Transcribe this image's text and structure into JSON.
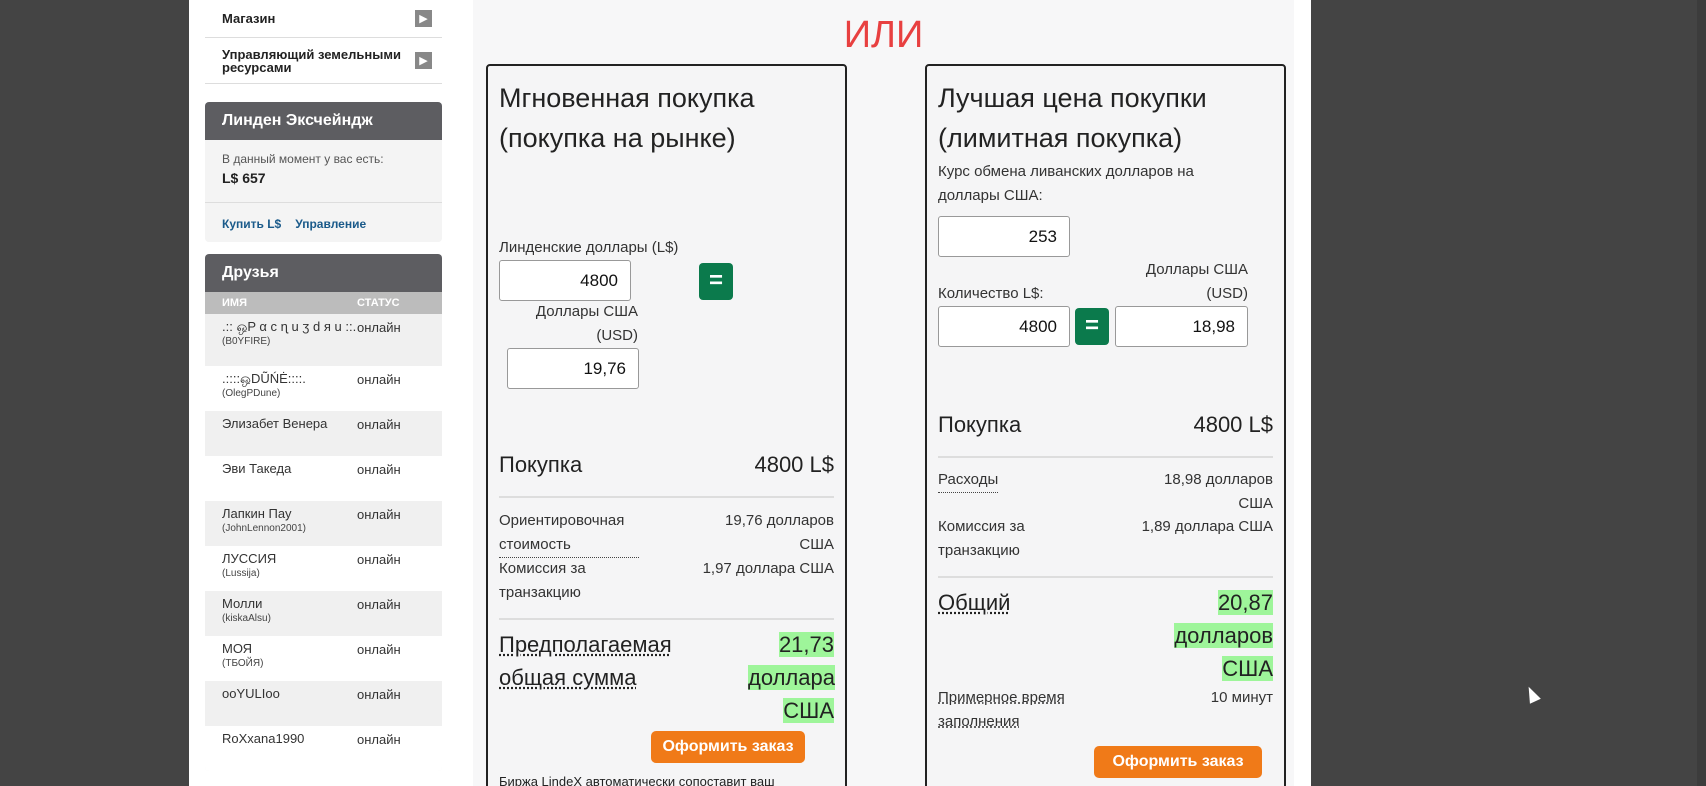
{
  "sidebar": {
    "links": [
      {
        "label": "Магазин"
      },
      {
        "label": "Управляющий земельными ресурсами"
      }
    ],
    "exchange": {
      "title": "Линден Эксчейндж",
      "balance_label": "В данный момент у вас есть:",
      "balance": "L$ 657",
      "buy_link": "Купить L$",
      "manage_link": "Управление"
    },
    "friends": {
      "title": "Друзья",
      "col_name": "ИМЯ",
      "col_status": "СТАТУС",
      "items": [
        {
          "name": ".:: ஒP α ϲ ɳ u ʒ d я u ::.",
          "sub": "(B0YFIRE)",
          "status": "онлайн"
        },
        {
          "name": ".::::ஒDŨŃĖ::::.",
          "sub": "(OlegPDune)",
          "status": "онлайн"
        },
        {
          "name": "Элизабет Венера",
          "sub": "",
          "status": "онлайн"
        },
        {
          "name": "Эви Такеда",
          "sub": "",
          "status": "онлайн"
        },
        {
          "name": "Лапкин Пау",
          "sub": "(JohnLennon2001)",
          "status": "онлайн"
        },
        {
          "name": "ЛУССИЯ",
          "sub": "(Lussija)",
          "status": "онлайн"
        },
        {
          "name": "Молли",
          "sub": "(kiskaAlsu)",
          "status": "онлайн"
        },
        {
          "name": "МОЯ",
          "sub": "(ТБОЙЯ)",
          "status": "онлайн"
        },
        {
          "name": "ooYULIoo",
          "sub": "",
          "status": "онлайн"
        },
        {
          "name": "RoXxana1990",
          "sub": "",
          "status": "онлайн"
        }
      ]
    }
  },
  "main": {
    "or_label": "ИЛИ",
    "instant": {
      "title": "Мгновенная покупка (покупка на рынке)",
      "ld_label": "Линденские доллары (L$)",
      "ld_value": "4800",
      "usd_label": "Доллары США (USD)",
      "usd_value": "19,76",
      "eq": "=",
      "purchase_label": "Покупка",
      "purchase_value": "4800 L$",
      "est_cost_label": "Ориентировочная стоимость",
      "est_cost_value": "19,76 долларов США",
      "fee_label": "Комиссия за транзакцию",
      "fee_value": "1,97 доллара США",
      "total_label": "Предполагаемая общая сумма",
      "total_value": "21,73 доллара США",
      "order_button": "Оформить заказ",
      "footer_text": "Биржа LindeX автоматически сопоставит ваш"
    },
    "limit": {
      "title": "Лучшая цена покупки (лимитная покупка)",
      "rate_label": "Курс обмена ливанских долларов на доллары США:",
      "rate_value": "253",
      "qty_label": "Количество L$:",
      "qty_value": "4800",
      "usd_label": "Доллары США (USD)",
      "usd_value": "18,98",
      "eq": "=",
      "purchase_label": "Покупка",
      "purchase_value": "4800 L$",
      "cost_label": "Расходы",
      "cost_value": "18,98 долларов США",
      "fee_label": "Комиссия за транзакцию",
      "fee_value": "1,89 доллара США",
      "total_label": "Общий",
      "total_value": "20,87 долларов США",
      "fill_label": "Примерное время заполнения",
      "fill_value": "10 минут",
      "order_button": "Оформить заказ"
    }
  }
}
